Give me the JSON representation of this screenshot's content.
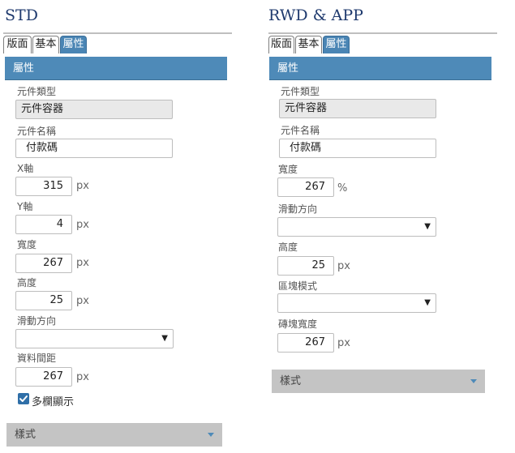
{
  "std": {
    "title": "STD",
    "tabs": [
      "版面",
      "基本",
      "屬性"
    ],
    "section_header": "屬性",
    "component_type": {
      "label": "元件類型",
      "value": "元件容器"
    },
    "component_name": {
      "label": "元件名稱",
      "value": "付款碼"
    },
    "x_axis": {
      "label": "X軸",
      "value": "315",
      "unit": "px"
    },
    "y_axis": {
      "label": "Y軸",
      "value": "4",
      "unit": "px"
    },
    "width": {
      "label": "寬度",
      "value": "267",
      "unit": "px"
    },
    "height": {
      "label": "高度",
      "value": "25",
      "unit": "px"
    },
    "scroll_direction": {
      "label": "滑動方向",
      "value": ""
    },
    "data_spacing": {
      "label": "資料間距",
      "value": "267",
      "unit": "px"
    },
    "multi_column": {
      "label": "多欄顯示",
      "checked": true
    },
    "style_label": "樣式"
  },
  "rwd": {
    "title": "RWD & APP",
    "tabs": [
      "版面",
      "基本",
      "屬性"
    ],
    "section_header": "屬性",
    "component_type": {
      "label": "元件類型",
      "value": "元件容器"
    },
    "component_name": {
      "label": "元件名稱",
      "value": "付款碼"
    },
    "width": {
      "label": "寬度",
      "value": "267",
      "unit": "%"
    },
    "scroll_direction": {
      "label": "滑動方向",
      "value": ""
    },
    "height": {
      "label": "高度",
      "value": "25",
      "unit": "px"
    },
    "block_mode": {
      "label": "區塊模式",
      "value": ""
    },
    "tile_width": {
      "label": "磚塊寬度",
      "value": "267",
      "unit": "px"
    },
    "style_label": "樣式"
  },
  "colors": {
    "accent": "#4e8ab8",
    "title": "#1f3a6e",
    "style_bar": "#c4c4c4"
  }
}
